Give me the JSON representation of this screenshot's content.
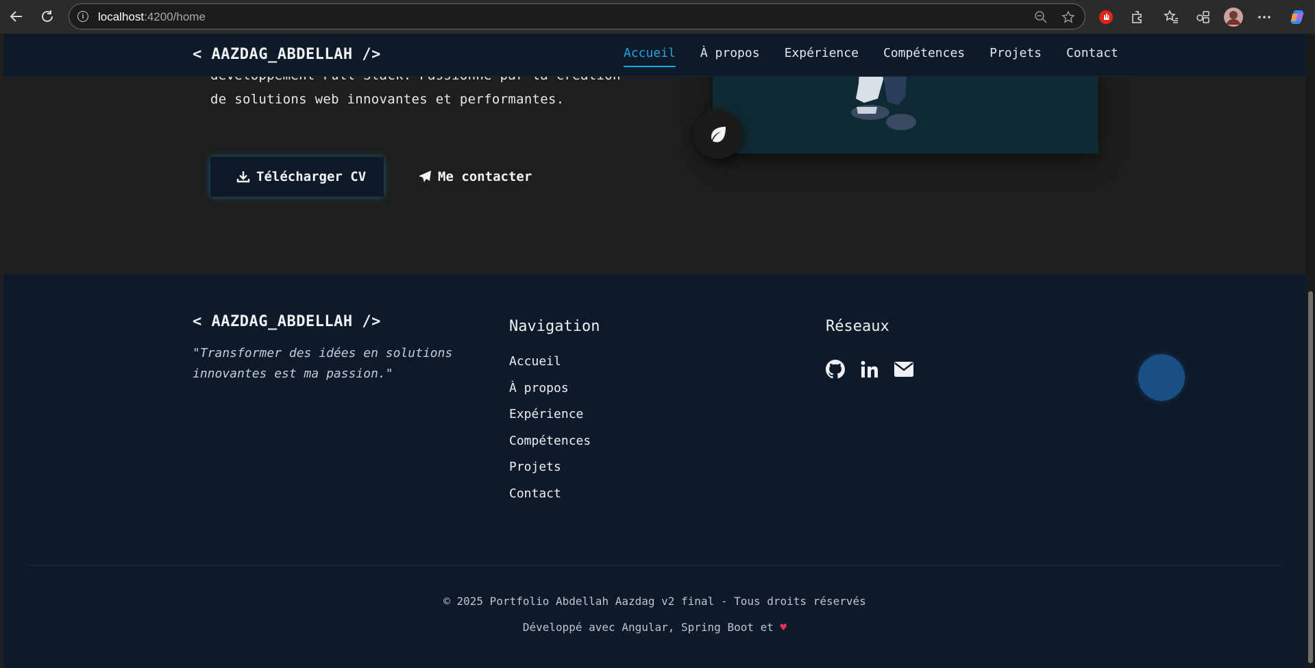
{
  "browser": {
    "url_host": "localhost",
    "url_path": ":4200/home"
  },
  "nav": {
    "logo": "< AAZDAG_ABDELLAH />",
    "items": [
      "Accueil",
      "À propos",
      "Expérience",
      "Compétences",
      "Projets",
      "Contact"
    ],
    "active": "Accueil"
  },
  "hero": {
    "line1": "développement Full Stack. Passionné par la création",
    "line2": "de solutions web innovantes et performantes.",
    "download_label": "Télécharger CV",
    "contact_label": "Me contacter"
  },
  "footer": {
    "logo": "< AAZDAG_ABDELLAH />",
    "quote_line1": "\"Transformer des idées en solutions",
    "quote_line2": "innovantes est ma passion.\"",
    "nav_title": "Navigation",
    "nav_items": [
      "Accueil",
      "À propos",
      "Expérience",
      "Compétences",
      "Projets",
      "Contact"
    ],
    "social_title": "Réseaux",
    "socials": [
      "github-icon",
      "linkedin-icon",
      "envelope-icon"
    ],
    "copyright": "© 2025 Portfolio Abdellah Aazdag v2 final - Tous droits réservés",
    "built_with": "Développé avec Angular, Spring Boot et"
  },
  "colors": {
    "accent": "#1aa7e6",
    "nav_bg": "#0f1a29",
    "page_bg": "#1e1e1e",
    "heart": "#e0315a"
  }
}
